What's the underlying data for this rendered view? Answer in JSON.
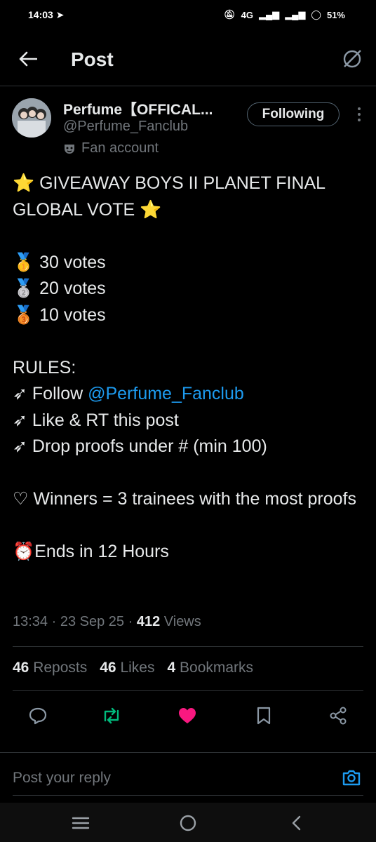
{
  "status_bar": {
    "time": "14:03",
    "network": "4G",
    "battery": "51%"
  },
  "header": {
    "title": "Post"
  },
  "author": {
    "display_name": "Perfume【OFFICAL...",
    "handle": "@Perfume_Fanclub",
    "badge": "Fan account",
    "follow_label": "Following"
  },
  "post": {
    "title_line": "GIVEAWAY BOYS II PLANET FINAL GLOBAL VOTE",
    "prizes": [
      "30 votes",
      "20 votes",
      "10 votes"
    ],
    "rules_heading": "RULES:",
    "rule_follow_prefix": "Follow ",
    "rule_follow_mention": "@Perfume_Fanclub",
    "rule_like": "Like & RT this post",
    "rule_drop": "Drop proofs under # (min 100)",
    "winners": "Winners = 3 trainees with the most proofs",
    "ends": "Ends in 12 Hours"
  },
  "meta": {
    "time": "13:34",
    "date": "23 Sep 25",
    "views_count": "412",
    "views_label": "Views"
  },
  "stats": {
    "reposts_count": "46",
    "reposts_label": "Reposts",
    "likes_count": "46",
    "likes_label": "Likes",
    "bookmarks_count": "4",
    "bookmarks_label": "Bookmarks"
  },
  "reply": {
    "placeholder": "Post your reply"
  },
  "colors": {
    "accent": "#1d9bf0",
    "repost_green": "#00ba7c",
    "like_pink": "#f91880"
  },
  "icons": [
    "back-arrow-icon",
    "grok-icon",
    "more-icon",
    "reply-icon",
    "repost-icon",
    "like-icon",
    "bookmark-icon",
    "share-icon",
    "camera-icon"
  ]
}
